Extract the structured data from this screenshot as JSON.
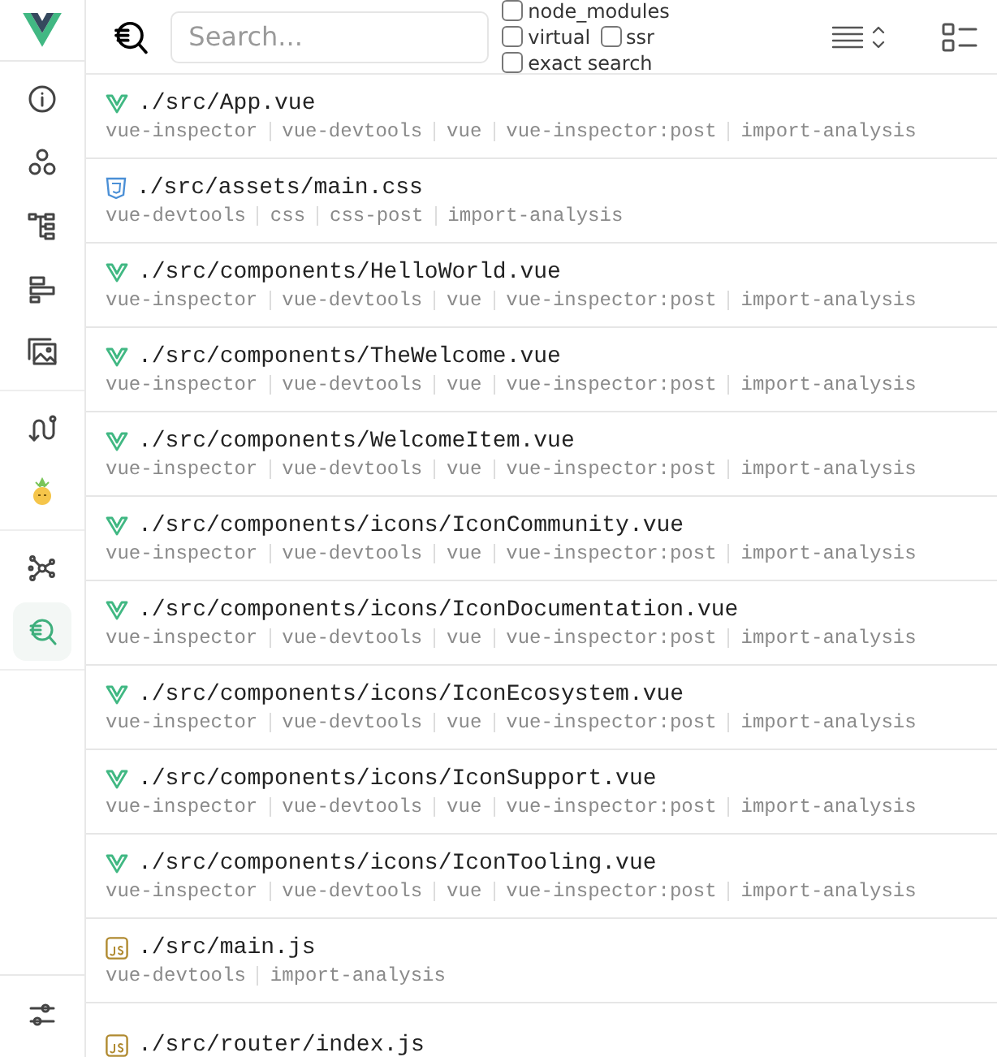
{
  "sidebar": {
    "groups": [
      [
        {
          "selected": false
        },
        {
          "selected": false
        },
        {
          "selected": false
        },
        {
          "selected": false
        },
        {
          "selected": false
        }
      ],
      [
        {
          "selected": false
        },
        {
          "selected": false
        }
      ],
      [
        {
          "selected": false
        },
        {
          "selected": true
        }
      ]
    ]
  },
  "toolbar": {
    "search": {
      "placeholder": "Search..."
    },
    "filters": [
      {
        "label": "node_modules",
        "checked": false
      },
      {
        "label": "virtual",
        "checked": false
      },
      {
        "label": "ssr",
        "checked": false
      },
      {
        "label": "exact search",
        "checked": false
      }
    ]
  },
  "modules": [
    {
      "kind": "vue",
      "path": "./src/App.vue",
      "plugins": [
        "vue-inspector",
        "vue-devtools",
        "vue",
        "vue-inspector:post",
        "import-analysis"
      ]
    },
    {
      "kind": "css",
      "path": "./src/assets/main.css",
      "plugins": [
        "vue-devtools",
        "css",
        "css-post",
        "import-analysis"
      ]
    },
    {
      "kind": "vue",
      "path": "./src/components/HelloWorld.vue",
      "plugins": [
        "vue-inspector",
        "vue-devtools",
        "vue",
        "vue-inspector:post",
        "import-analysis"
      ]
    },
    {
      "kind": "vue",
      "path": "./src/components/TheWelcome.vue",
      "plugins": [
        "vue-inspector",
        "vue-devtools",
        "vue",
        "vue-inspector:post",
        "import-analysis"
      ]
    },
    {
      "kind": "vue",
      "path": "./src/components/WelcomeItem.vue",
      "plugins": [
        "vue-inspector",
        "vue-devtools",
        "vue",
        "vue-inspector:post",
        "import-analysis"
      ]
    },
    {
      "kind": "vue",
      "path": "./src/components/icons/IconCommunity.vue",
      "plugins": [
        "vue-inspector",
        "vue-devtools",
        "vue",
        "vue-inspector:post",
        "import-analysis"
      ]
    },
    {
      "kind": "vue",
      "path": "./src/components/icons/IconDocumentation.vue",
      "plugins": [
        "vue-inspector",
        "vue-devtools",
        "vue",
        "vue-inspector:post",
        "import-analysis"
      ]
    },
    {
      "kind": "vue",
      "path": "./src/components/icons/IconEcosystem.vue",
      "plugins": [
        "vue-inspector",
        "vue-devtools",
        "vue",
        "vue-inspector:post",
        "import-analysis"
      ]
    },
    {
      "kind": "vue",
      "path": "./src/components/icons/IconSupport.vue",
      "plugins": [
        "vue-inspector",
        "vue-devtools",
        "vue",
        "vue-inspector:post",
        "import-analysis"
      ]
    },
    {
      "kind": "vue",
      "path": "./src/components/icons/IconTooling.vue",
      "plugins": [
        "vue-inspector",
        "vue-devtools",
        "vue",
        "vue-inspector:post",
        "import-analysis"
      ]
    },
    {
      "kind": "js",
      "path": "./src/main.js",
      "plugins": [
        "vue-devtools",
        "import-analysis"
      ]
    },
    {
      "kind": "js",
      "path": "./src/router/index.js"
    }
  ]
}
